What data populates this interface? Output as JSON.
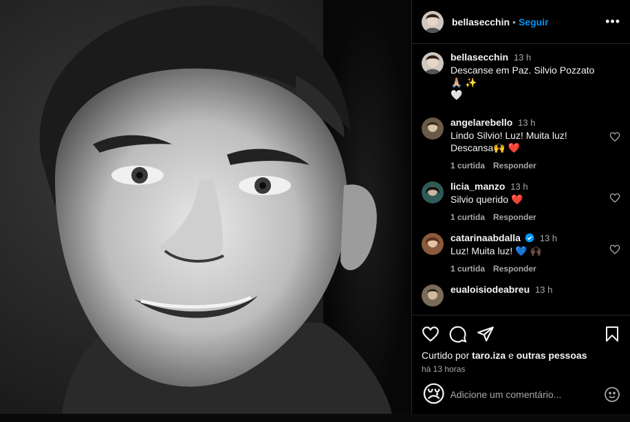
{
  "post": {
    "author": "bellasecchin",
    "follow_label": "Seguir",
    "more_label": "•••",
    "caption": {
      "user": "bellasecchin",
      "time": "13 h",
      "text": "Descanse em Paz. Silvio Pozzato 🙏🏼 ✨",
      "text2": "🤍"
    },
    "comments": [
      {
        "user": "angelarebello",
        "time": "13 h",
        "text": "Lindo Silvio! Luz! Muita luz!",
        "text2": "Descansa🙌 ❤️",
        "likes": "1 curtida",
        "reply": "Responder",
        "avatar_color": "#6b5a4a"
      },
      {
        "user": "licia_manzo",
        "time": "13 h",
        "text": "Silvio querido ❤️",
        "likes": "1 curtida",
        "reply": "Responder",
        "avatar_color": "#2f5a58"
      },
      {
        "user": "catarinaabdalla",
        "time": "13 h",
        "text": "Luz! Muita luz! 💙 🙌🏿",
        "likes": "1 curtida",
        "reply": "Responder",
        "avatar_color": "#8a5a3c",
        "verified": true
      },
      {
        "user": "eualoisiodeabreu",
        "time": "13 h",
        "avatar_color": "#7a6b5a"
      }
    ],
    "liked_by_prefix": "Curtido por",
    "liked_by_user": "taro.iza",
    "liked_by_and": "e",
    "liked_by_rest": "outras pessoas",
    "posted_ago": "há 13 horas",
    "emoji_button": "😢",
    "comment_placeholder": "Adicione um comentário..."
  },
  "colors": {
    "accent": "#0095f6",
    "muted": "#a8a8a8",
    "like_red": "#ed4956"
  },
  "icons": [
    "heart-icon",
    "comment-icon",
    "share-icon",
    "bookmark-icon",
    "more-icon",
    "smile-icon",
    "verified-icon"
  ]
}
